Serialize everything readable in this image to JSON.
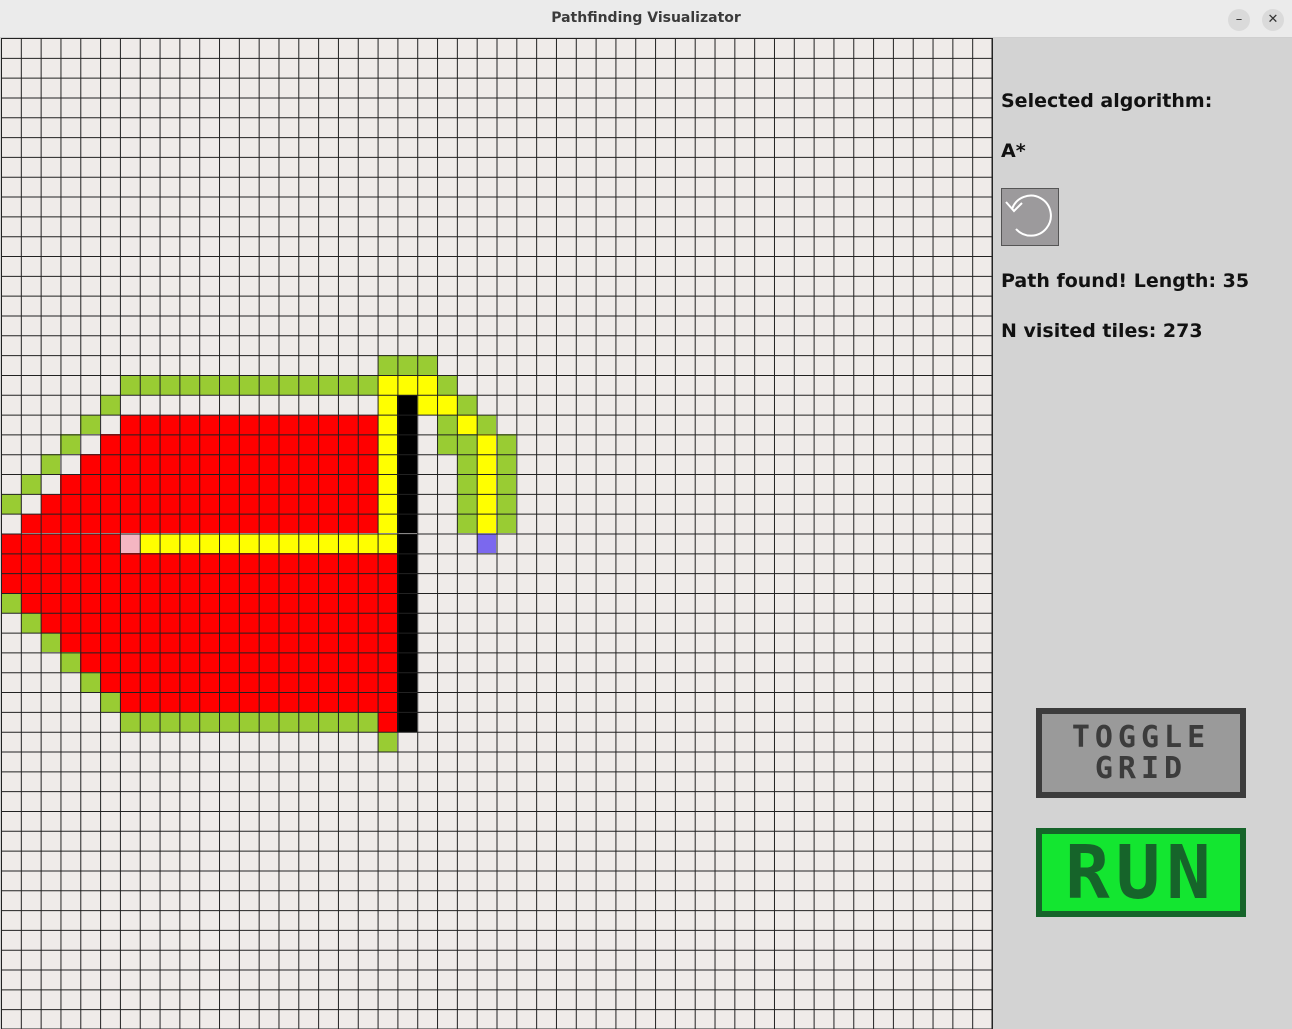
{
  "window": {
    "title": "Pathfinding Visualizator",
    "minimize_glyph": "–",
    "close_glyph": "✕"
  },
  "grid": {
    "columns": 50,
    "rows": 50,
    "gridlines_visible": true,
    "colors": {
      "empty": "#efebe9",
      "gridline": "#222222",
      "visited": "#ff0000",
      "frontier": "#99cc33",
      "path": "#ffff00",
      "wall": "#000000",
      "start": "#f4b6c2",
      "end": "#7b68ee"
    },
    "visited_runs": [
      [
        18,
        19,
        20
      ],
      [
        19,
        6,
        20
      ],
      [
        20,
        5,
        20
      ],
      [
        21,
        4,
        20
      ],
      [
        22,
        3,
        20
      ],
      [
        23,
        2,
        20
      ],
      [
        24,
        1,
        20
      ],
      [
        25,
        0,
        20
      ],
      [
        26,
        0,
        20
      ],
      [
        27,
        0,
        20
      ],
      [
        28,
        1,
        20
      ],
      [
        29,
        1,
        20
      ],
      [
        30,
        2,
        20
      ],
      [
        31,
        3,
        20
      ],
      [
        32,
        4,
        20
      ],
      [
        33,
        5,
        20
      ],
      [
        34,
        6,
        20
      ],
      [
        35,
        19,
        20
      ]
    ],
    "frontier_runs": [
      [
        16,
        19,
        22
      ],
      [
        17,
        6,
        19
      ],
      [
        17,
        22,
        23
      ],
      [
        18,
        5,
        6
      ],
      [
        18,
        23,
        24
      ],
      [
        19,
        4,
        5
      ],
      [
        19,
        22,
        23
      ],
      [
        19,
        24,
        25
      ],
      [
        20,
        3,
        4
      ],
      [
        20,
        22,
        24
      ],
      [
        20,
        25,
        26
      ],
      [
        21,
        2,
        3
      ],
      [
        21,
        23,
        24
      ],
      [
        21,
        25,
        26
      ],
      [
        22,
        1,
        2
      ],
      [
        22,
        23,
        24
      ],
      [
        22,
        25,
        26
      ],
      [
        23,
        0,
        1
      ],
      [
        23,
        23,
        24
      ],
      [
        23,
        25,
        26
      ],
      [
        24,
        23,
        24
      ],
      [
        24,
        25,
        26
      ],
      [
        28,
        0,
        1
      ],
      [
        29,
        1,
        2
      ],
      [
        30,
        2,
        3
      ],
      [
        31,
        3,
        4
      ],
      [
        32,
        4,
        5
      ],
      [
        33,
        5,
        6
      ],
      [
        34,
        6,
        19
      ],
      [
        35,
        19,
        20
      ]
    ],
    "path_runs": [
      [
        17,
        19,
        22
      ],
      [
        18,
        19,
        20
      ],
      [
        18,
        21,
        23
      ],
      [
        19,
        19,
        20
      ],
      [
        19,
        23,
        24
      ],
      [
        20,
        19,
        20
      ],
      [
        20,
        24,
        25
      ],
      [
        21,
        19,
        20
      ],
      [
        21,
        24,
        25
      ],
      [
        22,
        19,
        20
      ],
      [
        22,
        24,
        25
      ],
      [
        23,
        19,
        20
      ],
      [
        23,
        24,
        25
      ],
      [
        24,
        19,
        20
      ],
      [
        24,
        24,
        25
      ],
      [
        25,
        7,
        20
      ]
    ],
    "wall_runs": [
      [
        18,
        20,
        21
      ],
      [
        19,
        20,
        21
      ],
      [
        20,
        20,
        21
      ],
      [
        21,
        20,
        21
      ],
      [
        22,
        20,
        21
      ],
      [
        23,
        20,
        21
      ],
      [
        24,
        20,
        21
      ],
      [
        25,
        20,
        21
      ],
      [
        26,
        20,
        21
      ],
      [
        27,
        20,
        21
      ],
      [
        28,
        20,
        21
      ],
      [
        29,
        20,
        21
      ],
      [
        30,
        20,
        21
      ],
      [
        31,
        20,
        21
      ],
      [
        32,
        20,
        21
      ],
      [
        33,
        20,
        21
      ],
      [
        34,
        20,
        21
      ]
    ],
    "start_cell": [
      25,
      6
    ],
    "end_cell": [
      25,
      24
    ]
  },
  "sidebar": {
    "algorithm_heading": "Selected algorithm:",
    "algorithm_name": "A*",
    "reset_icon": "reset-arrow-icon",
    "status_text": "Path found! Length: 35",
    "visited_text": "N visited tiles: 273",
    "toggle_grid_label": "TOGGLE\nGRID",
    "run_label": "RUN",
    "colors": {
      "toggle_bg": "#9a9a9a",
      "toggle_border": "#3c3c3c",
      "run_bg": "#13e630",
      "run_border": "#16642a"
    }
  }
}
